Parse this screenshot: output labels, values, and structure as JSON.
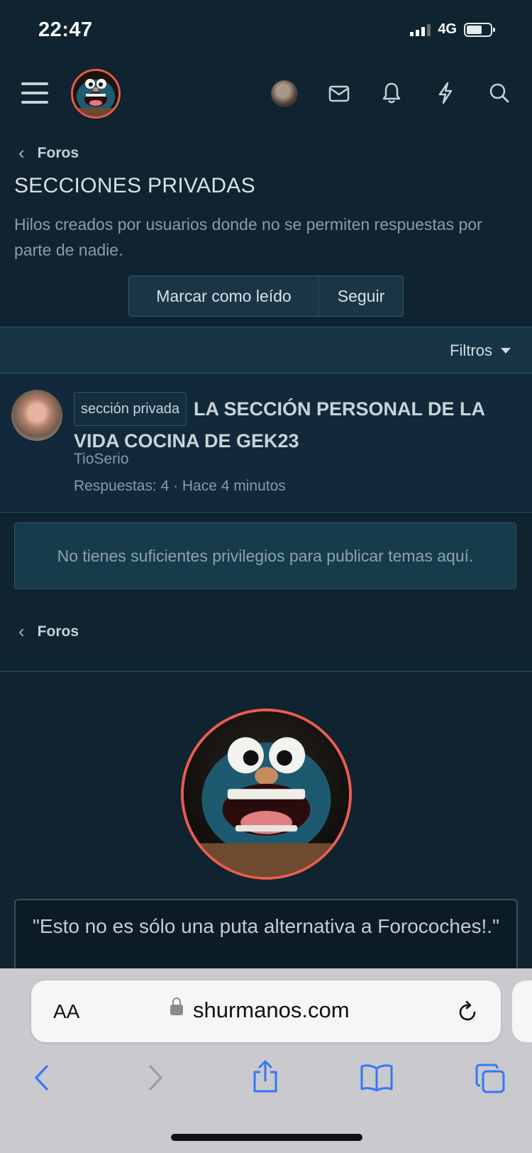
{
  "status_bar": {
    "time": "22:47",
    "network": "4G"
  },
  "header": {
    "icons": [
      "menu-icon",
      "site-logo",
      "user-avatar",
      "mail-icon",
      "bell-icon",
      "bolt-icon",
      "search-icon"
    ]
  },
  "breadcrumb": {
    "label": "Foros"
  },
  "forum": {
    "title": "SECCIONES PRIVADAS",
    "description": "Hilos creados por usuarios donde no se permiten respuestas por parte de nadie.",
    "mark_read_label": "Marcar como leído",
    "follow_label": "Seguir"
  },
  "filters": {
    "label": "Filtros"
  },
  "thread": {
    "prefix": "sección privada",
    "title": "LA SECCIÓN PERSONAL DE LA VIDA COCINA DE GEK23",
    "author": "TioSerio",
    "meta": "Respuestas: 4 · Hace 4 minutos"
  },
  "notice": {
    "text": "No tienes suficientes privilegios para publicar temas aquí."
  },
  "footer_breadcrumb": {
    "label": "Foros"
  },
  "footer": {
    "quote": "\"Esto no es sólo una puta alternativa a Forocoches!.\""
  },
  "browser": {
    "text_size_label": "AA",
    "url": "shurmanos.com"
  },
  "colors": {
    "background": "#0f2330",
    "accent_ring": "#ea5d4c",
    "link_blue": "#3478f6"
  }
}
